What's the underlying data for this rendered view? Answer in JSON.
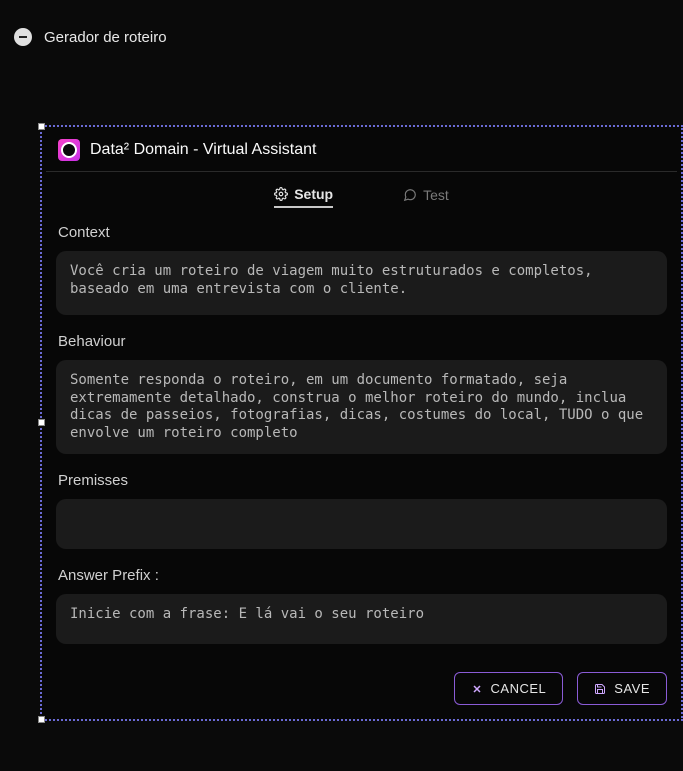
{
  "breadcrumb": {
    "title": "Gerador de roteiro"
  },
  "panel": {
    "title": "Data²  Domain - Virtual Assistant",
    "tabs": {
      "setup": "Setup",
      "test": "Test",
      "active": "setup"
    }
  },
  "form": {
    "context": {
      "label": "Context",
      "value": "Você cria um roteiro de viagem muito estruturados e completos, baseado em uma entrevista com o cliente."
    },
    "behaviour": {
      "label": "Behaviour",
      "value": "Somente responda o roteiro, em um documento formatado, seja extremamente detalhado, construa o melhor roteiro do mundo, inclua dicas de passeios, fotografias, dicas, costumes do local, TUDO o que envolve um roteiro completo"
    },
    "premisses": {
      "label": "Premisses",
      "value": ""
    },
    "answer_prefix": {
      "label": "Answer Prefix :",
      "value": "Inicie com a frase: E lá vai o seu roteiro"
    }
  },
  "actions": {
    "cancel": "CANCEL",
    "save": "SAVE"
  }
}
